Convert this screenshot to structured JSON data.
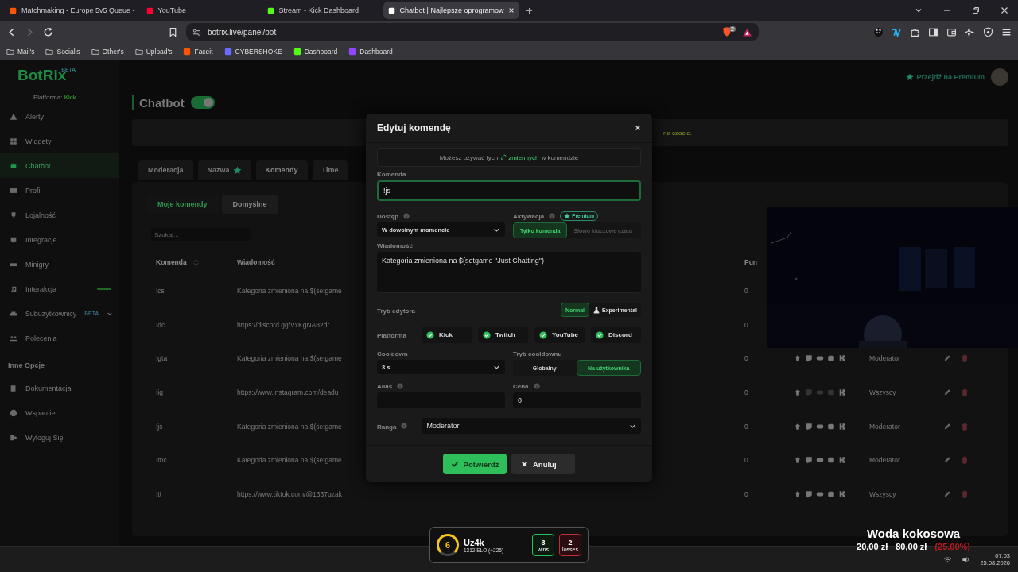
{
  "browser": {
    "tabs": [
      {
        "title": "Matchmaking - Europe 5v5 Queue - ",
        "kind": "faceit",
        "selected": false
      },
      {
        "title": "YouTube",
        "kind": "youtube",
        "selected": false
      },
      {
        "title": "Stream - Kick Dashboard",
        "kind": "kick",
        "selected": false
      },
      {
        "title": "Chatbot | Najlepsze oprogramow",
        "kind": "botrix",
        "selected": true
      }
    ],
    "url": "botrix.live/panel/bot",
    "shield_count": "2",
    "bookmarks": [
      {
        "label": "Mail's",
        "kind": "folder"
      },
      {
        "label": "Social's",
        "kind": "folder"
      },
      {
        "label": "Other's",
        "kind": "folder"
      },
      {
        "label": "Upload's",
        "kind": "folder"
      },
      {
        "label": "Faceit",
        "kind": "faceit"
      },
      {
        "label": "CYBERSHOKE",
        "kind": "cybershoke"
      },
      {
        "label": "Dashboard",
        "kind": "kick"
      },
      {
        "label": "Dashboard",
        "kind": "twitch"
      }
    ]
  },
  "sidebar": {
    "logo": "BotRix",
    "logo_badge": "BETA",
    "platform_label": "Platforma:",
    "platform": "Kick",
    "items": [
      {
        "label": "Alerty",
        "kind": "warning",
        "selected": false
      },
      {
        "label": "Widgety",
        "kind": "grid",
        "selected": false
      },
      {
        "label": "Chatbot",
        "kind": "bot",
        "selected": true
      },
      {
        "label": "Profil",
        "kind": "card",
        "selected": false
      },
      {
        "label": "Lojalność",
        "kind": "trophy",
        "selected": false
      },
      {
        "label": "Integracje",
        "kind": "plug",
        "selected": false
      },
      {
        "label": "Minigry",
        "kind": "gamepad",
        "selected": false
      },
      {
        "label": "Interakcja",
        "kind": "music",
        "selected": false,
        "new": true
      },
      {
        "label": "Subużytkownicy",
        "kind": "users",
        "selected": false,
        "badge": "BETA",
        "expandable": true
      },
      {
        "label": "Polecenia",
        "kind": "people",
        "selected": false
      }
    ],
    "section": "Inne Opcje",
    "other_items": [
      {
        "label": "Dokumentacja",
        "kind": "book",
        "selected": false
      },
      {
        "label": "Wsparcie",
        "kind": "help",
        "selected": false
      },
      {
        "label": "Wyloguj Się",
        "kind": "logout",
        "selected": false
      }
    ]
  },
  "header": {
    "premium": "Przejdź na Premium"
  },
  "page": {
    "title": "Chatbot",
    "enabled": true,
    "banner_tail": "na czacie.",
    "tabs": [
      {
        "label": "Moderacja",
        "selected": false
      },
      {
        "label": "Nazwa",
        "selected": false,
        "star": true
      },
      {
        "label": "Komendy",
        "selected": true
      },
      {
        "label": "Time",
        "selected": false
      }
    ],
    "subtabs": [
      {
        "label": "Moje komendy",
        "selected": true
      },
      {
        "label": "Domyślne",
        "selected": false
      }
    ],
    "search": {
      "placeholder": "Szukaj..."
    },
    "table": {
      "columns": [
        "Komenda",
        "Wiadomość",
        "Pun"
      ],
      "rows": [
        {
          "command": "!cs",
          "message": "Kategoria zmieniona na $(setgame",
          "points": "0"
        },
        {
          "command": "!dc",
          "message": "https://discord.gg/VxKgNA82dr",
          "points": "0"
        },
        {
          "command": "!gta",
          "message": "Kategoria zmieniona na $(setgame",
          "points": "0",
          "role": "Moderator",
          "platforms": [
            {
              "kind": "bot",
              "enabled": true
            },
            {
              "kind": "twitch",
              "enabled": true
            },
            {
              "kind": "youtube",
              "enabled": true
            },
            {
              "kind": "discord",
              "enabled": true
            },
            {
              "kind": "kick",
              "enabled": true
            }
          ]
        },
        {
          "command": "!ig",
          "message": "https://www.instagram.com/deadu",
          "points": "0",
          "role": "Wszyscy",
          "platforms": [
            {
              "kind": "bot",
              "enabled": true
            },
            {
              "kind": "twitch",
              "enabled": false
            },
            {
              "kind": "youtube",
              "enabled": false
            },
            {
              "kind": "discord",
              "enabled": false
            },
            {
              "kind": "kick",
              "enabled": true
            }
          ]
        },
        {
          "command": "!js",
          "message": "Kategoria zmieniona na $(setgame",
          "points": "0",
          "role": "Moderator",
          "platforms": [
            {
              "kind": "bot",
              "enabled": true
            },
            {
              "kind": "twitch",
              "enabled": true
            },
            {
              "kind": "youtube",
              "enabled": true
            },
            {
              "kind": "discord",
              "enabled": true
            },
            {
              "kind": "kick",
              "enabled": true
            }
          ]
        },
        {
          "command": "!mc",
          "message": "Kategoria zmieniona na $(setgame",
          "points": "0",
          "role": "Moderator",
          "platforms": [
            {
              "kind": "bot",
              "enabled": true
            },
            {
              "kind": "twitch",
              "enabled": true
            },
            {
              "kind": "youtube",
              "enabled": true
            },
            {
              "kind": "discord",
              "enabled": true
            },
            {
              "kind": "kick",
              "enabled": true
            }
          ]
        },
        {
          "command": "!tt",
          "message": "https://www.tiktok.com/@1337uzak",
          "points": "0",
          "role": "Wszyscy",
          "platforms": [
            {
              "kind": "bot",
              "enabled": true
            },
            {
              "kind": "twitch",
              "enabled": true
            },
            {
              "kind": "youtube",
              "enabled": true
            },
            {
              "kind": "discord",
              "enabled": true
            },
            {
              "kind": "kick",
              "enabled": true
            }
          ]
        }
      ]
    }
  },
  "modal": {
    "title": "Edytuj komendę",
    "info_before": "Możesz używać tych",
    "info_link": "zmiennych",
    "info_after": "w komendzie",
    "command_label": "Komenda",
    "command_value": "!js",
    "access_label": "Dostęp",
    "access_value": "W dowolnym momencie",
    "activation_label": "Aktywacja",
    "premium": "Premium",
    "activation_options": [
      {
        "label": "Tylko komenda",
        "selected": true
      },
      {
        "label": "Słowo kluczowe czatu",
        "selected": false
      }
    ],
    "message_label": "Wiadomość",
    "message_value": "Kategoria zmieniona na $(setgame \"Just Chatting\")",
    "editor_label": "Tryb edytora",
    "editor_options": [
      {
        "label": "Normal",
        "selected": true
      },
      {
        "label": "Experimental",
        "selected": false,
        "kind": "flask"
      }
    ],
    "platform_label": "Platforma",
    "platforms": [
      {
        "label": "Kick",
        "checked": true
      },
      {
        "label": "Twitch",
        "checked": true
      },
      {
        "label": "YouTube",
        "checked": true
      },
      {
        "label": "Discord",
        "checked": true
      }
    ],
    "cooldown_label": "Cooldown",
    "cooldown_value": "3 s",
    "cooldown_mode_label": "Tryb cooldownu",
    "cooldown_modes": [
      {
        "label": "Globalny",
        "selected": false
      },
      {
        "label": "Na użytkownika",
        "selected": true
      }
    ],
    "alias_label": "Alias",
    "price_label": "Cena",
    "price_value": "0",
    "rank_label": "Ranga",
    "rank_value": "Moderator",
    "confirm": "Potwierdź",
    "cancel": "Anuluj"
  },
  "stream_overlay": {
    "elo": {
      "level": "6",
      "name": "Uz4k",
      "elo": "1312 ELO (+225)",
      "wins": "3",
      "wins_label": "wins",
      "losses": "2",
      "losses_label": "losses"
    },
    "goal": {
      "title": "Woda kokosowa",
      "current": "20,00 zł",
      "target": "80,00 zł",
      "percent": "(25.00%)"
    }
  },
  "taskbar": {
    "time": "07:03",
    "date": "25.08.2026"
  }
}
